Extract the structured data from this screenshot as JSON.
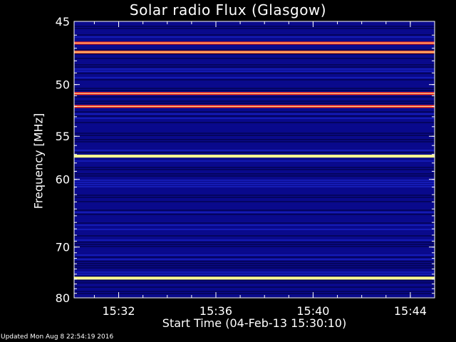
{
  "chart_data": {
    "type": "heatmap",
    "title": "Solar radio Flux (Glasgow)",
    "xlabel": "Start Time (04-Feb-13 15:30:10)",
    "ylabel": "Frequency [MHz]",
    "x_range": [
      "15:30:10",
      "15:45:00"
    ],
    "ylim": [
      45,
      80
    ],
    "x_ticks": [
      "15:32",
      "15:36",
      "15:40",
      "15:44"
    ],
    "y_ticks": [
      45,
      50,
      55,
      60,
      70,
      80
    ],
    "colormap": [
      "#00003a",
      "#0a0a8c",
      "#1e2ad6",
      "#c0283c",
      "#ff2a10",
      "#ffff7a"
    ],
    "background_color": "#0a0a8c",
    "bright_bands_mhz": [
      {
        "center": 46.6,
        "color": "#ff2a10"
      },
      {
        "center": 47.3,
        "color": "#ff5a20"
      },
      {
        "center": 50.8,
        "color": "#ff2a10"
      },
      {
        "center": 52.0,
        "color": "#ff2a10"
      },
      {
        "center": 57.2,
        "color": "#ffff7a"
      },
      {
        "center": 75.8,
        "color": "#ffff7a"
      }
    ],
    "footer": "Updated Mon Aug  8 22:54:19 2016"
  }
}
